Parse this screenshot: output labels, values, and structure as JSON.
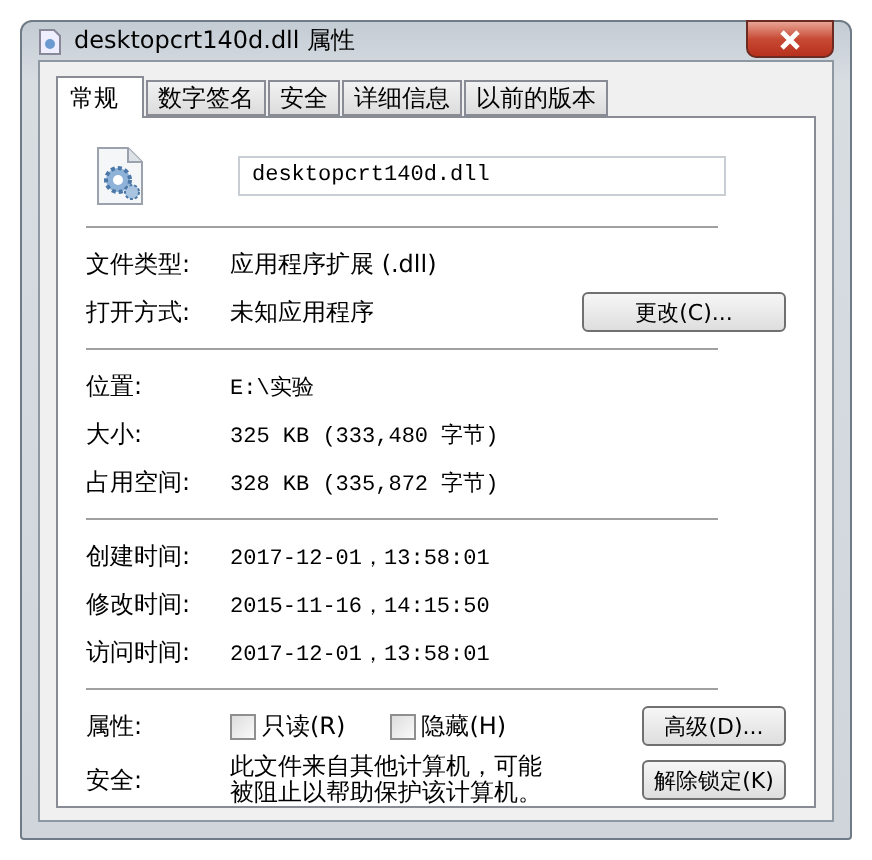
{
  "window": {
    "title": "desktopcrt140d.dll 属性"
  },
  "tabs": [
    {
      "label": "常规",
      "selected": true
    },
    {
      "label": "数字签名",
      "selected": false
    },
    {
      "label": "安全",
      "selected": false
    },
    {
      "label": "详细信息",
      "selected": false
    },
    {
      "label": "以前的版本",
      "selected": false
    }
  ],
  "file_name": {
    "value": "desktopcrt140d.dll"
  },
  "sections": [
    {
      "rows": [
        {
          "kind": "info",
          "label": "文件类型:",
          "value": "应用程序扩展 (.dll)"
        },
        {
          "kind": "info",
          "label": "打开方式:",
          "value": "未知应用程序",
          "button": "更改(C)..."
        }
      ]
    },
    {
      "rows": [
        {
          "kind": "info",
          "label": "位置:",
          "value": "E:\\实验"
        },
        {
          "kind": "info",
          "label": "大小:",
          "value": "325 KB (333,480 字节)"
        },
        {
          "kind": "info",
          "label": "占用空间:",
          "value": "328 KB (335,872 字节)"
        }
      ]
    },
    {
      "rows": [
        {
          "kind": "info",
          "label": "创建时间:",
          "value": "2017-12-01，13:58:01"
        },
        {
          "kind": "info",
          "label": "修改时间:",
          "value": "2015-11-16，14:15:50"
        },
        {
          "kind": "info",
          "label": "访问时间:",
          "value": "2017-12-01，13:58:01"
        }
      ]
    },
    {
      "rows": [
        {
          "kind": "checkboxes",
          "label": "属性:",
          "checkboxes": [
            {
              "label": "只读(R)",
              "checked": false
            },
            {
              "label": "隐藏(H)",
              "checked": false
            }
          ],
          "button": "高级(D)..."
        },
        {
          "kind": "security",
          "label": "安全:",
          "value": "此文件来自其他计算机，可能被阻止以帮助保护该计算机。",
          "button": "解除锁定(K)"
        }
      ]
    }
  ]
}
